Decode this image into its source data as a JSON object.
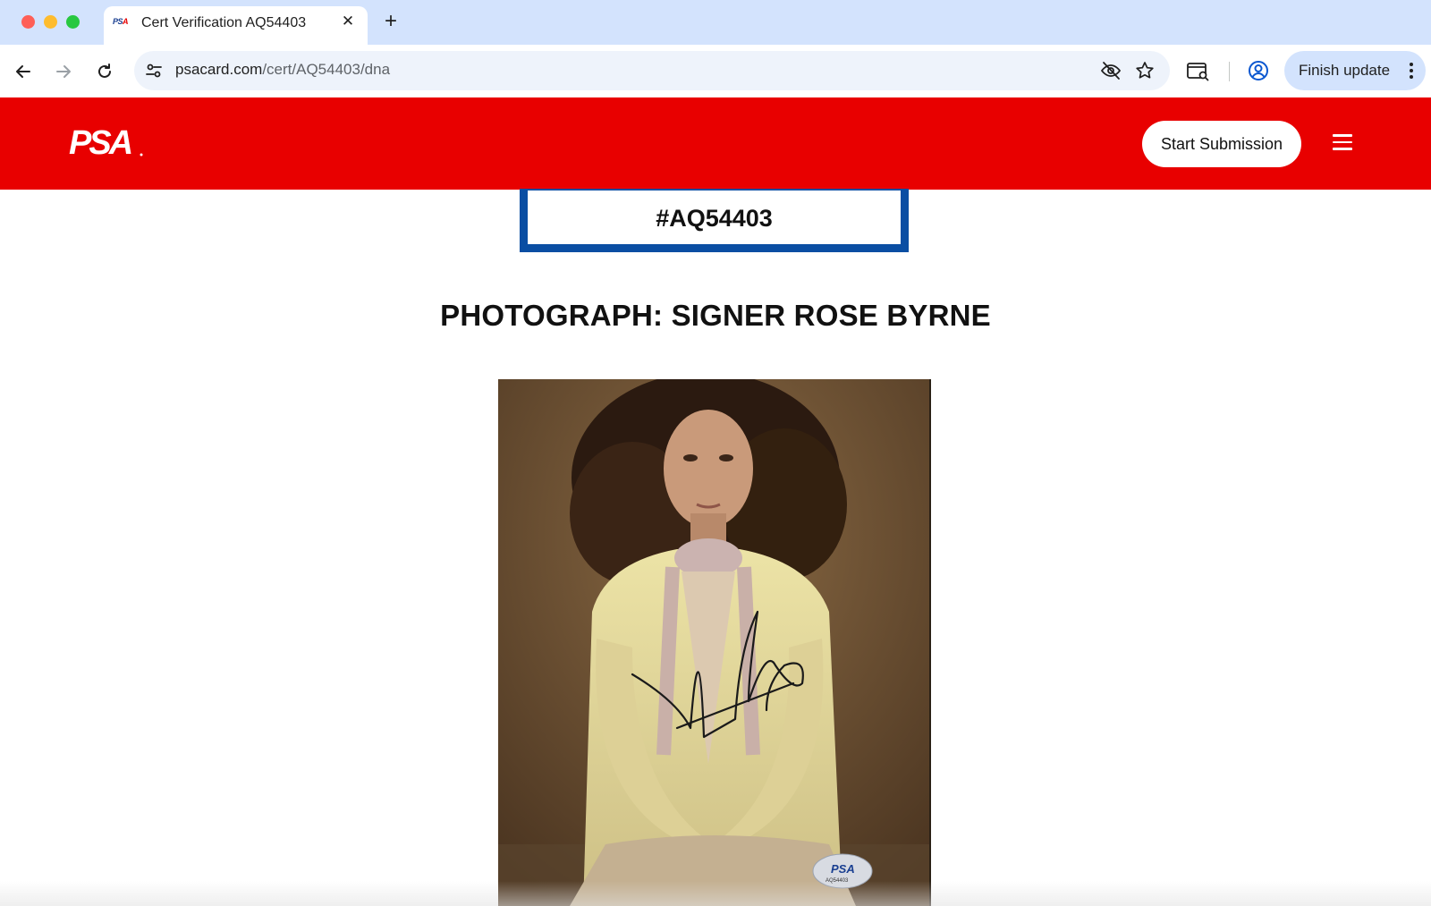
{
  "browser": {
    "tab_title": "Cert Verification AQ54403",
    "favicon_text_ps": "PS",
    "favicon_text_a": "A",
    "close_glyph": "✕",
    "newtab_glyph": "+",
    "url_host": "psacard.com",
    "url_path": "/cert/AQ54403/dna",
    "finish_update_label": "Finish update",
    "icons": [
      "back-icon",
      "forward-icon",
      "reload-icon",
      "site-info-icon",
      "eye-off-icon",
      "star-icon",
      "side-panel-icon",
      "profile-icon",
      "more-vert-icon"
    ]
  },
  "header": {
    "logo_text": "PSA",
    "start_submission_label": "Start Submission",
    "brand_color": "#e80000"
  },
  "cert": {
    "number": "#AQ54403",
    "border_color": "#0a4ea3"
  },
  "item": {
    "title": "PHOTOGRAPH: SIGNER ROSE BYRNE"
  },
  "photo": {
    "sticker_brand": "PSA",
    "sticker_cert": "AQ54403"
  }
}
